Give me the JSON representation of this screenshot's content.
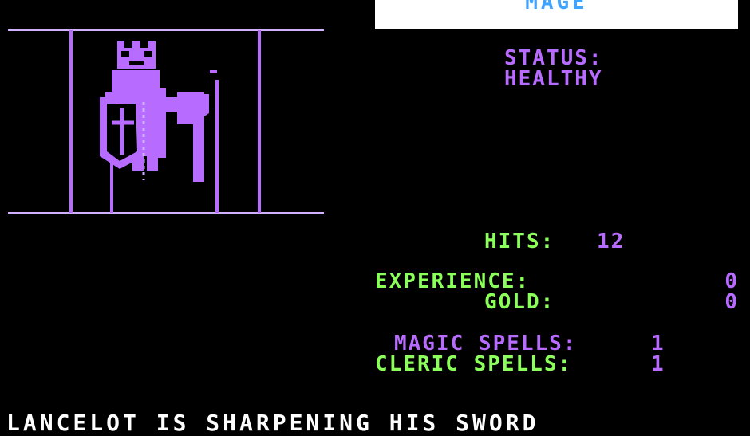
{
  "title": {
    "label": "MAGE",
    "accent_color": "#3fa4ff",
    "bg_color": "#ffffff"
  },
  "status": {
    "label": "STATUS:",
    "value": "HEALTHY"
  },
  "stats": {
    "hits_label": "HITS:",
    "hits_value": "12",
    "experience_label": "EXPERIENCE:",
    "experience_value": "0",
    "gold_label": "GOLD:",
    "gold_value": "0",
    "magic_spells_label": "MAGIC SPELLS:",
    "magic_spells_value": "1",
    "cleric_spells_label": "CLERIC SPELLS:",
    "cleric_spells_value": "1"
  },
  "message": {
    "text": "LANCELOT IS SHARPENING HIS SWORD"
  },
  "portrait": {
    "icon": "knight-with-shield-and-axe-icon",
    "color": "#b86cff"
  },
  "colors": {
    "background": "#000000",
    "purple": "#b86cff",
    "green": "#8bff5a",
    "white": "#ffffff"
  }
}
